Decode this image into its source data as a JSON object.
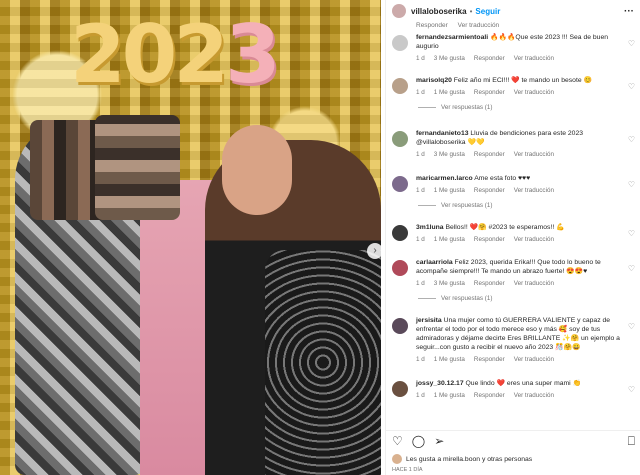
{
  "header": {
    "username": "villaloboserika",
    "separator": "•",
    "follow_label": "Seguir",
    "more_label": "···"
  },
  "top_meta": [
    "Responder",
    "Ver traducción"
  ],
  "comments": [
    {
      "user": "fernandezsarmientoali",
      "text": "🔥🔥🔥Que este 2023 !!! Sea de buen augurio",
      "time": "1 d",
      "likes": "3 Me gusta",
      "reply": "Responder",
      "translate": "Ver traducción",
      "avatar_color": "#c9c9c9"
    },
    {
      "user": "marisolq20",
      "text": "Feliz año mi ECI!!! ❤️ te mando un besote 😊",
      "time": "1 d",
      "likes": "1 Me gusta",
      "reply": "Responder",
      "translate": "Ver traducción",
      "avatar_color": "#b8a08a",
      "replies": "Ver respuestas (1)"
    },
    {
      "user": "fernandanieto13",
      "text": "Lluvia de bendiciones para este 2023 @villaloboserika 💛💛",
      "time": "1 d",
      "likes": "3 Me gusta",
      "reply": "Responder",
      "translate": "Ver traducción",
      "avatar_color": "#8a9c7a"
    },
    {
      "user": "maricarmen.larco",
      "text": "Ame esta foto ♥♥♥",
      "time": "1 d",
      "likes": "1 Me gusta",
      "reply": "Responder",
      "translate": "Ver traducción",
      "avatar_color": "#7c6a8c",
      "replies": "Ver respuestas (1)"
    },
    {
      "user": "3m1luna",
      "text": "Bellos!! ❤️🤗 #2023 te esperamos!! 💪",
      "time": "1 d",
      "likes": "1 Me gusta",
      "reply": "Responder",
      "translate": "Ver traducción",
      "avatar_color": "#3a3a3a"
    },
    {
      "user": "carlaarriola",
      "text": "Feliz 2023, querida Erika!!! Que todo lo bueno te acompañe siempre!!! Te mando un abrazo fuerte! 😍😍♥",
      "time": "1 d",
      "likes": "3 Me gusta",
      "reply": "Responder",
      "translate": "Ver traducción",
      "avatar_color": "#b04a5a",
      "replies": "Ver respuestas (1)"
    },
    {
      "user": "jersisita",
      "text": "Una mujer como tú GUERRERA VALIENTE y capaz de enfrentar el todo por el todo merece eso y más 🥰 soy de tus admiradoras y déjame decirte Eres BRILLANTE ✨🤗 un ejemplo a seguir...con gusto a recibir el nuevo año 2023 🎊🤗😀",
      "time": "1 d",
      "likes": "1 Me gusta",
      "reply": "Responder",
      "translate": "Ver traducción",
      "avatar_color": "#5a4a5a"
    },
    {
      "user": "jossy_30.12.17",
      "text": "Que lindo ❤️ eres una super mami 👏",
      "time": "1 d",
      "likes": "1 Me gusta",
      "reply": "Responder",
      "translate": "Ver traducción",
      "avatar_color": "#6a5040"
    }
  ],
  "photo": {
    "balloons_part1": "202",
    "balloons_part2": "3"
  },
  "actions": {
    "like_icon": "♡",
    "comment_icon": "◯",
    "share_icon": "➢",
    "bookmark_icon": "⎕"
  },
  "likes_text": "Les gusta a mirella.boon y otras personas",
  "date_text": "HACE 1 DÍA",
  "nav_arrow": "›"
}
